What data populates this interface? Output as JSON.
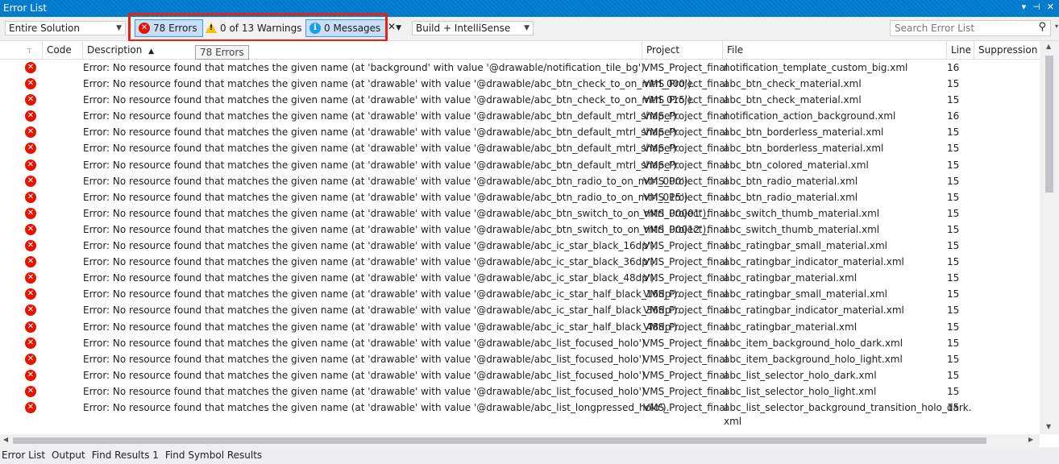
{
  "window": {
    "title": "Error List"
  },
  "toolbar": {
    "scope": "Entire Solution",
    "errors_label": "78 Errors",
    "warnings_label": "0 of 13 Warnings",
    "messages_label": "0 Messages",
    "build_filter": "Build + IntelliSense",
    "search_placeholder": "Search Error List"
  },
  "tooltip": "78 Errors",
  "columns": {
    "code": "Code",
    "description": "Description",
    "project": "Project",
    "file": "File",
    "line": "Line",
    "suppression": "Suppression St"
  },
  "rows": [
    {
      "description": "Error: No resource found that matches the given name (at 'background' with value '@drawable/notification_tile_bg').",
      "project": "VMS_Project_final",
      "file": "notification_template_custom_big.xml",
      "line": "16"
    },
    {
      "description": "Error: No resource found that matches the given name (at 'drawable' with value '@drawable/abc_btn_check_to_on_mtrl_000').",
      "project": "VMS_Project_final",
      "file": "abc_btn_check_material.xml",
      "line": "15"
    },
    {
      "description": "Error: No resource found that matches the given name (at 'drawable' with value '@drawable/abc_btn_check_to_on_mtrl_015').",
      "project": "VMS_Project_final",
      "file": "abc_btn_check_material.xml",
      "line": "15"
    },
    {
      "description": "Error: No resource found that matches the given name (at 'drawable' with value '@drawable/abc_btn_default_mtrl_shape').",
      "project": "VMS_Project_final",
      "file": "notification_action_background.xml",
      "line": "16"
    },
    {
      "description": "Error: No resource found that matches the given name (at 'drawable' with value '@drawable/abc_btn_default_mtrl_shape').",
      "project": "VMS_Project_final",
      "file": "abc_btn_borderless_material.xml",
      "line": "15"
    },
    {
      "description": "Error: No resource found that matches the given name (at 'drawable' with value '@drawable/abc_btn_default_mtrl_shape').",
      "project": "VMS_Project_final",
      "file": "abc_btn_borderless_material.xml",
      "line": "15"
    },
    {
      "description": "Error: No resource found that matches the given name (at 'drawable' with value '@drawable/abc_btn_default_mtrl_shape').",
      "project": "VMS_Project_final",
      "file": "abc_btn_colored_material.xml",
      "line": "15"
    },
    {
      "description": "Error: No resource found that matches the given name (at 'drawable' with value '@drawable/abc_btn_radio_to_on_mtrl_000').",
      "project": "VMS_Project_final",
      "file": "abc_btn_radio_material.xml",
      "line": "15"
    },
    {
      "description": "Error: No resource found that matches the given name (at 'drawable' with value '@drawable/abc_btn_radio_to_on_mtrl_015').",
      "project": "VMS_Project_final",
      "file": "abc_btn_radio_material.xml",
      "line": "15"
    },
    {
      "description": "Error: No resource found that matches the given name (at 'drawable' with value '@drawable/abc_btn_switch_to_on_mtrl_00001').",
      "project": "VMS_Project_final",
      "file": "abc_switch_thumb_material.xml",
      "line": "15"
    },
    {
      "description": "Error: No resource found that matches the given name (at 'drawable' with value '@drawable/abc_btn_switch_to_on_mtrl_00012').",
      "project": "VMS_Project_final",
      "file": "abc_switch_thumb_material.xml",
      "line": "15"
    },
    {
      "description": "Error: No resource found that matches the given name (at 'drawable' with value '@drawable/abc_ic_star_black_16dp').",
      "project": "VMS_Project_final",
      "file": "abc_ratingbar_small_material.xml",
      "line": "15"
    },
    {
      "description": "Error: No resource found that matches the given name (at 'drawable' with value '@drawable/abc_ic_star_black_36dp').",
      "project": "VMS_Project_final",
      "file": "abc_ratingbar_indicator_material.xml",
      "line": "15"
    },
    {
      "description": "Error: No resource found that matches the given name (at 'drawable' with value '@drawable/abc_ic_star_black_48dp').",
      "project": "VMS_Project_final",
      "file": "abc_ratingbar_material.xml",
      "line": "15"
    },
    {
      "description": "Error: No resource found that matches the given name (at 'drawable' with value '@drawable/abc_ic_star_half_black_16dp').",
      "project": "VMS_Project_final",
      "file": "abc_ratingbar_small_material.xml",
      "line": "15"
    },
    {
      "description": "Error: No resource found that matches the given name (at 'drawable' with value '@drawable/abc_ic_star_half_black_36dp').",
      "project": "VMS_Project_final",
      "file": "abc_ratingbar_indicator_material.xml",
      "line": "15"
    },
    {
      "description": "Error: No resource found that matches the given name (at 'drawable' with value '@drawable/abc_ic_star_half_black_48dp').",
      "project": "VMS_Project_final",
      "file": "abc_ratingbar_material.xml",
      "line": "15"
    },
    {
      "description": "Error: No resource found that matches the given name (at 'drawable' with value '@drawable/abc_list_focused_holo').",
      "project": "VMS_Project_final",
      "file": "abc_item_background_holo_dark.xml",
      "line": "15"
    },
    {
      "description": "Error: No resource found that matches the given name (at 'drawable' with value '@drawable/abc_list_focused_holo').",
      "project": "VMS_Project_final",
      "file": "abc_item_background_holo_light.xml",
      "line": "15"
    },
    {
      "description": "Error: No resource found that matches the given name (at 'drawable' with value '@drawable/abc_list_focused_holo').",
      "project": "VMS_Project_final",
      "file": "abc_list_selector_holo_dark.xml",
      "line": "15"
    },
    {
      "description": "Error: No resource found that matches the given name (at 'drawable' with value '@drawable/abc_list_focused_holo').",
      "project": "VMS_Project_final",
      "file": "abc_list_selector_holo_light.xml",
      "line": "15"
    },
    {
      "description": "Error: No resource found that matches the given name (at 'drawable' with value '@drawable/abc_list_longpressed_holo').",
      "project": "VMS_Project_final",
      "file": "abc_list_selector_background_transition_holo_dark.",
      "file2": "xml",
      "line": "15"
    }
  ],
  "bottom_tabs": [
    "Error List",
    "Output",
    "Find Results 1",
    "Find Symbol Results"
  ],
  "icons": {
    "error": "error-circle-icon",
    "warning": "warning-triangle-icon",
    "info": "info-circle-icon",
    "search": "search-icon",
    "filter": "clear-filter-icon",
    "pin": "pin-icon",
    "close": "close-icon"
  },
  "colors": {
    "title_bar": "#007acc",
    "error_red": "#e51400",
    "highlight_box": "#e8220f",
    "active_button_bg": "#c9def5"
  }
}
